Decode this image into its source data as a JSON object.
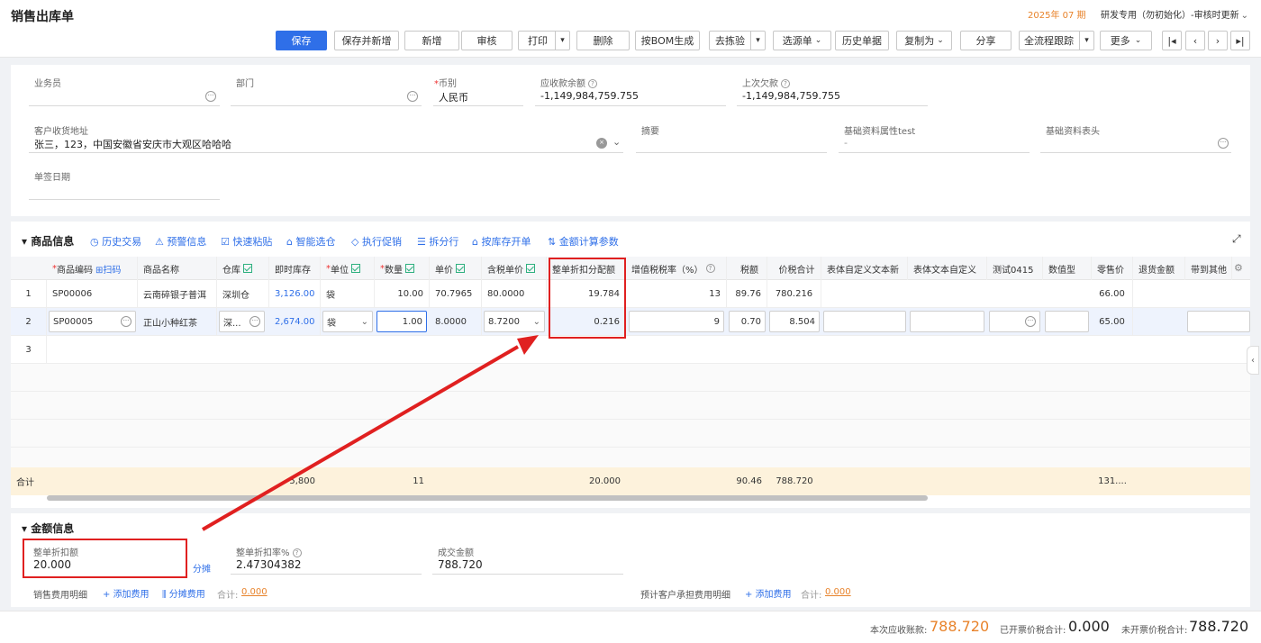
{
  "header": {
    "title": "销售出库单",
    "period": "2025年 07 期",
    "org": "研发专用（勿初始化）-审核时更新"
  },
  "toolbar": {
    "save": "保存",
    "save_new": "保存并新增",
    "add": "新增",
    "audit": "审核",
    "print": "打印",
    "delete": "删除",
    "bom": "按BOM生成",
    "pick": "去拣验",
    "source": "选源单",
    "history": "历史单据",
    "copy_as": "复制为",
    "share": "分享",
    "trace": "全流程跟踪",
    "more": "更多"
  },
  "form": {
    "salesman_label": "业务员",
    "dept_label": "部门",
    "currency_label": "币别",
    "currency_value": "人民币",
    "receivable_label": "应收款余额",
    "receivable_value": "-1,149,984,759.755",
    "last_debt_label": "上次欠款",
    "last_debt_value": "-1,149,984,759.755",
    "address_label": "客户收货地址",
    "address_value": "张三，123，中国安徽省安庆市大观区哈哈哈",
    "summary_label": "摘要",
    "basic_attr_label": "基础资料属性test",
    "basic_attr_value": "-",
    "basic_header_label": "基础资料表头",
    "sign_date_label": "单签日期"
  },
  "goods": {
    "section_title": "商品信息",
    "tools": [
      "历史交易",
      "预警信息",
      "快速粘贴",
      "智能选仓",
      "执行促销",
      "拆分行",
      "按库存开单",
      "金额计算参数"
    ],
    "scan": "扫码",
    "columns": [
      "商品编码",
      "商品名称",
      "仓库",
      "即时库存",
      "单位",
      "数量",
      "单价",
      "含税单价",
      "整单折扣分配额",
      "增值税税率（%）",
      "税额",
      "价税合计",
      "表体自定义文本新",
      "表体文本自定义",
      "测试0415",
      "数值型",
      "零售价",
      "退货金额",
      "带到其他"
    ],
    "rows": [
      {
        "idx": "1",
        "code": "SP00006",
        "name": "云南碎银子普洱",
        "wh": "深圳仓",
        "stock": "3,126.00",
        "unit": "袋",
        "qty": "10.00",
        "price": "70.7965",
        "tax_price": "80.0000",
        "discount": "19.784",
        "rate": "13",
        "tax": "89.76",
        "total": "780.216",
        "retail": "66.00"
      },
      {
        "idx": "2",
        "code": "SP00005",
        "name": "正山小种红茶",
        "wh": "深...",
        "stock": "2,674.00",
        "unit": "袋",
        "qty": "1.00",
        "price": "8.0000",
        "tax_price": "8.7200",
        "discount": "0.216",
        "rate": "9",
        "tax": "0.70",
        "total": "8.504",
        "retail": "65.00"
      },
      {
        "idx": "3"
      }
    ],
    "sum_label": "合计",
    "sum_stock": "5,800",
    "sum_qty": "11",
    "sum_discount": "20.000",
    "sum_tax": "90.46",
    "sum_total": "788.720",
    "sum_retail": "131...."
  },
  "amount": {
    "section_title": "金额信息",
    "discount_label": "整单折扣额",
    "discount_value": "20.000",
    "split": "分摊",
    "discount_rate_label": "整单折扣率%",
    "discount_rate_value": "2.47304382",
    "deal_label": "成交金额",
    "deal_value": "788.720",
    "sales_fee_label": "销售费用明细",
    "add_fee": "添加费用",
    "split_fee": "分摊费用",
    "subtotal_label": "合计:",
    "subtotal_value": "0.000",
    "cust_fee_label": "预计客户承担费用明细",
    "add_fee2": "添加费用",
    "subtotal_label2": "合计:",
    "subtotal_value2": "0.000"
  },
  "footer": {
    "this_receive_label": "本次应收账款:",
    "this_receive_value": "788.720",
    "invoiced_label": "已开票价税合计:",
    "invoiced_value": "0.000",
    "uninvoiced_label": "未开票价税合计:",
    "uninvoiced_value": "788.720"
  },
  "colors": {
    "primary": "#2f6fe8",
    "accent": "#e8832b",
    "highlight": "#e02020"
  },
  "icons": [
    "more-dots-icon",
    "question-icon",
    "clear-icon",
    "chevron-down-icon",
    "fullscreen-icon",
    "settings-icon",
    "first-page-icon",
    "prev-icon",
    "next-icon",
    "last-page-icon"
  ]
}
